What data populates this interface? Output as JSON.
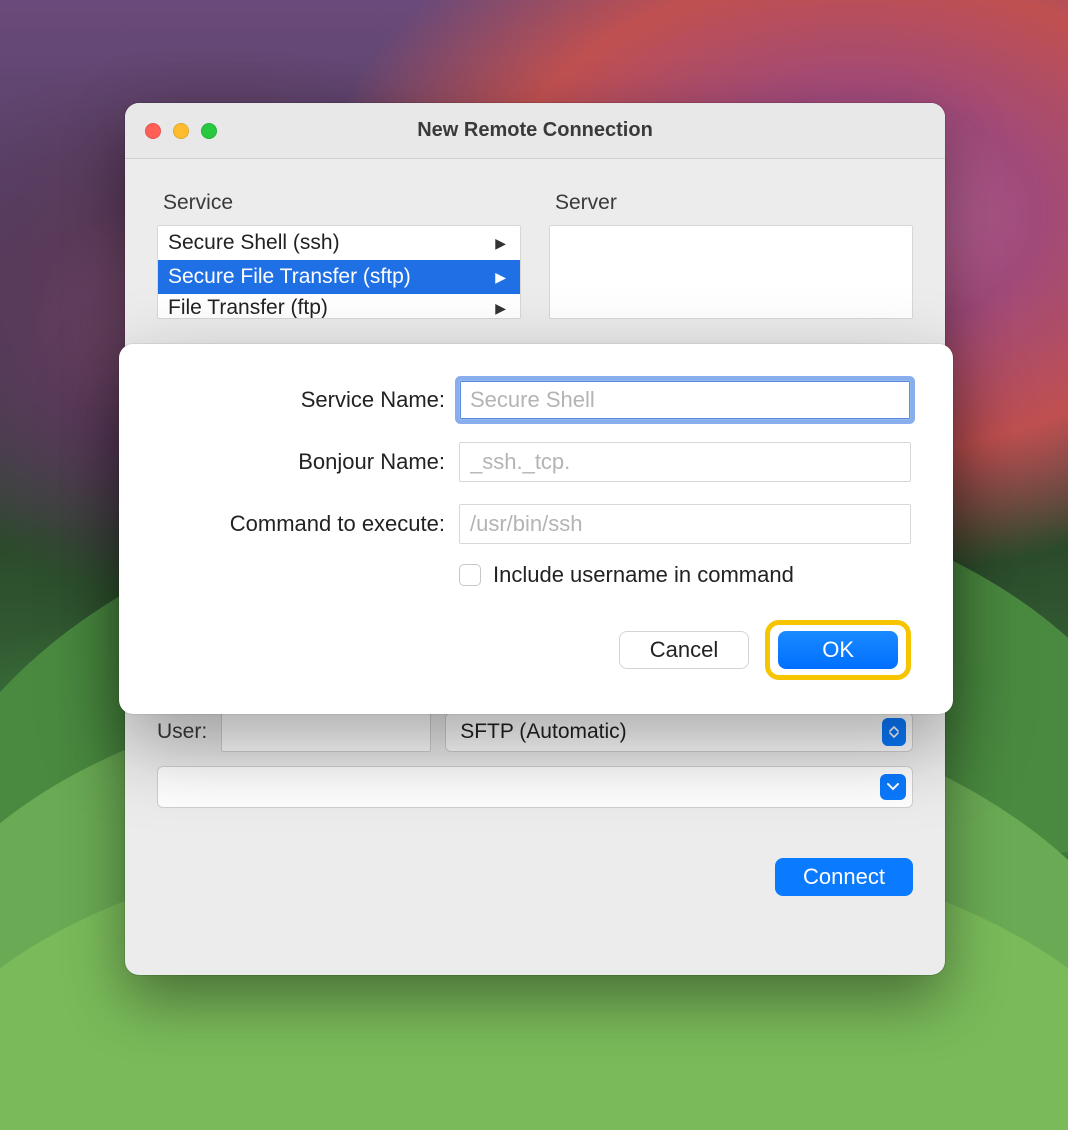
{
  "window": {
    "title": "New Remote Connection"
  },
  "columns": {
    "service_header": "Service",
    "server_header": "Server",
    "services": [
      {
        "label": "Secure Shell (ssh)",
        "selected": false
      },
      {
        "label": "Secure File Transfer (sftp)",
        "selected": true
      },
      {
        "label": "File Transfer (ftp)",
        "selected": false
      }
    ]
  },
  "sheet": {
    "service_name_label": "Service Name:",
    "service_name_placeholder": "Secure Shell",
    "bonjour_label": "Bonjour Name:",
    "bonjour_placeholder": "_ssh._tcp.",
    "command_label": "Command to execute:",
    "command_placeholder": "/usr/bin/ssh",
    "include_username_label": "Include username in command",
    "cancel_label": "Cancel",
    "ok_label": "OK"
  },
  "footer": {
    "user_label": "User:",
    "protocol_label": "SFTP (Automatic)",
    "connect_label": "Connect"
  }
}
